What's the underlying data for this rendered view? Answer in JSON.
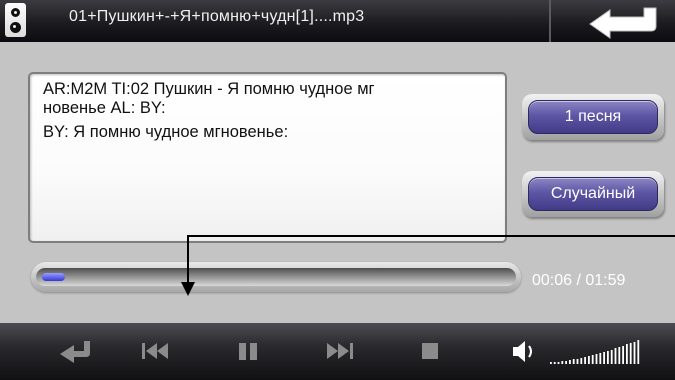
{
  "title_bar": {
    "track_filename": "01+Пушкин+-+Я+помню+чудн[1]....mp3"
  },
  "lyrics": {
    "line1": "AR:M2M  TI:02 Пушкин - Я помню чудное мг",
    "line2": "новенье   AL:  BY:",
    "line3": "BY: Я помню чудное мгновенье:"
  },
  "buttons": {
    "repeat_mode_label": "1 песня",
    "shuffle_label": "Случайный"
  },
  "playback": {
    "time": "00:06 / 01:59",
    "progress_fraction": 0.05
  },
  "volume": {
    "level_fraction": 1.0
  },
  "icons": {
    "speaker": "speaker-icon",
    "back": "return-arrow-icon",
    "undo": "return-icon",
    "prev": "previous-track-icon",
    "pause": "pause-icon",
    "next": "next-track-icon",
    "stop": "stop-icon",
    "volume": "volume-icon"
  },
  "colors": {
    "button_purple": "#5d56a4",
    "progress_blue": "#3438d6",
    "toolbar_dark": "#1c1c20"
  }
}
